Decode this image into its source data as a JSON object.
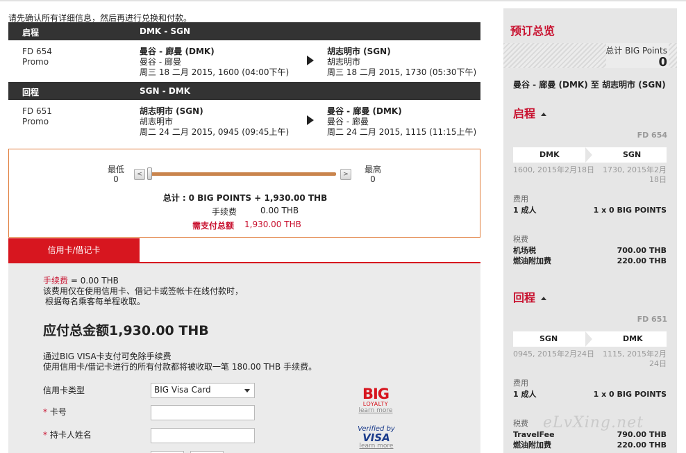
{
  "intro": "请先确认所有详细信息，然后再进行兑换和付款。",
  "legs": [
    {
      "label": "启程",
      "route": "DMK - SGN",
      "flight_no": "FD 654",
      "fare": "Promo",
      "from_name": "曼谷 - 廊曼 (DMK)",
      "from_city": "曼谷 - 廊曼",
      "from_time": "周三 18 二月 2015, 1600 (04:00下午)",
      "to_name": "胡志明市 (SGN)",
      "to_city": "胡志明市",
      "to_time": "周三 18 二月 2015, 1730 (05:30下午)"
    },
    {
      "label": "回程",
      "route": "SGN - DMK",
      "flight_no": "FD 651",
      "fare": "Promo",
      "from_name": "胡志明市 (SGN)",
      "from_city": "胡志明市",
      "from_time": "周二 24 二月 2015, 0945 (09:45上午)",
      "to_name": "曼谷 - 廊曼 (DMK)",
      "to_city": "曼谷 - 廊曼",
      "to_time": "周二 24 二月 2015, 1115 (11:15上午)"
    }
  ],
  "points": {
    "min_label": "最低",
    "min_value": "0",
    "max_label": "最高",
    "max_value": "0",
    "left_btn": "<",
    "right_btn": ">",
    "slider_fraction": 0,
    "total_label": "总计 :",
    "total_value": "0 BIG POINTS + 1,930.00 THB",
    "fee_label": "手续费",
    "fee_value": "0.00 THB",
    "pay_label": "需支付总额",
    "pay_value": "1,930.00 THB"
  },
  "payment": {
    "tab": "信用卡/借记卡",
    "fee_prefix": "手续费",
    "fee_amount": " = 0.00 THB",
    "fee_line2": "该费用仅在使用信用卡、借记卡或签帐卡在线付款时，",
    "fee_line3": "根据每名乘客每单程收取。",
    "grand_total_label": "应付总金额",
    "grand_total_value": "1,930.00 THB",
    "visa_line1": "通过BIG VISA卡支付可免除手续费",
    "visa_line2": "使用信用卡/借记卡进行的所有付款都将被收取一笔 180.00 THB 手续费。",
    "card_type_label": "信用卡类型",
    "card_type_value": "BIG Visa Card",
    "card_no_label": "卡号",
    "holder_label": "持卡人姓名",
    "card_no_value": "",
    "holder_value": "",
    "big_logo": "BIG",
    "big_logo_sub": "LOYALTY",
    "visa_logo_1": "Verified by",
    "visa_logo_2": "VISA",
    "learn_more": "learn more"
  },
  "sidebar": {
    "title": "预订总览",
    "points_label": "总计 BIG Points",
    "points_value": "0",
    "route": "曼谷 - 廊曼 (DMK) 至 胡志明市 (SGN)",
    "legs": [
      {
        "title": "启程",
        "flight_no": "FD 654",
        "from": "DMK",
        "to": "SGN",
        "dep": "1600, 2015年2月18日",
        "arr": "1730, 2015年2月18日",
        "fare_label": "费用",
        "pax": "1 成人",
        "pax_points": "1 x 0 BIG POINTS",
        "tax_label": "税费",
        "taxes": [
          {
            "name": "机场税",
            "amount": "700.00 THB"
          },
          {
            "name": "燃油附加费",
            "amount": "220.00 THB"
          }
        ]
      },
      {
        "title": "回程",
        "flight_no": "FD 651",
        "from": "SGN",
        "to": "DMK",
        "dep": "0945, 2015年2月24日",
        "arr": "1115, 2015年2月24日",
        "fare_label": "费用",
        "pax": "1 成人",
        "pax_points": "1 x 0 BIG POINTS",
        "tax_label": "税费",
        "taxes": [
          {
            "name": "TravelFee",
            "amount": "790.00 THB"
          },
          {
            "name": "燃油附加费",
            "amount": "220.00 THB"
          }
        ]
      }
    ]
  },
  "watermark": "eLvXing.net"
}
